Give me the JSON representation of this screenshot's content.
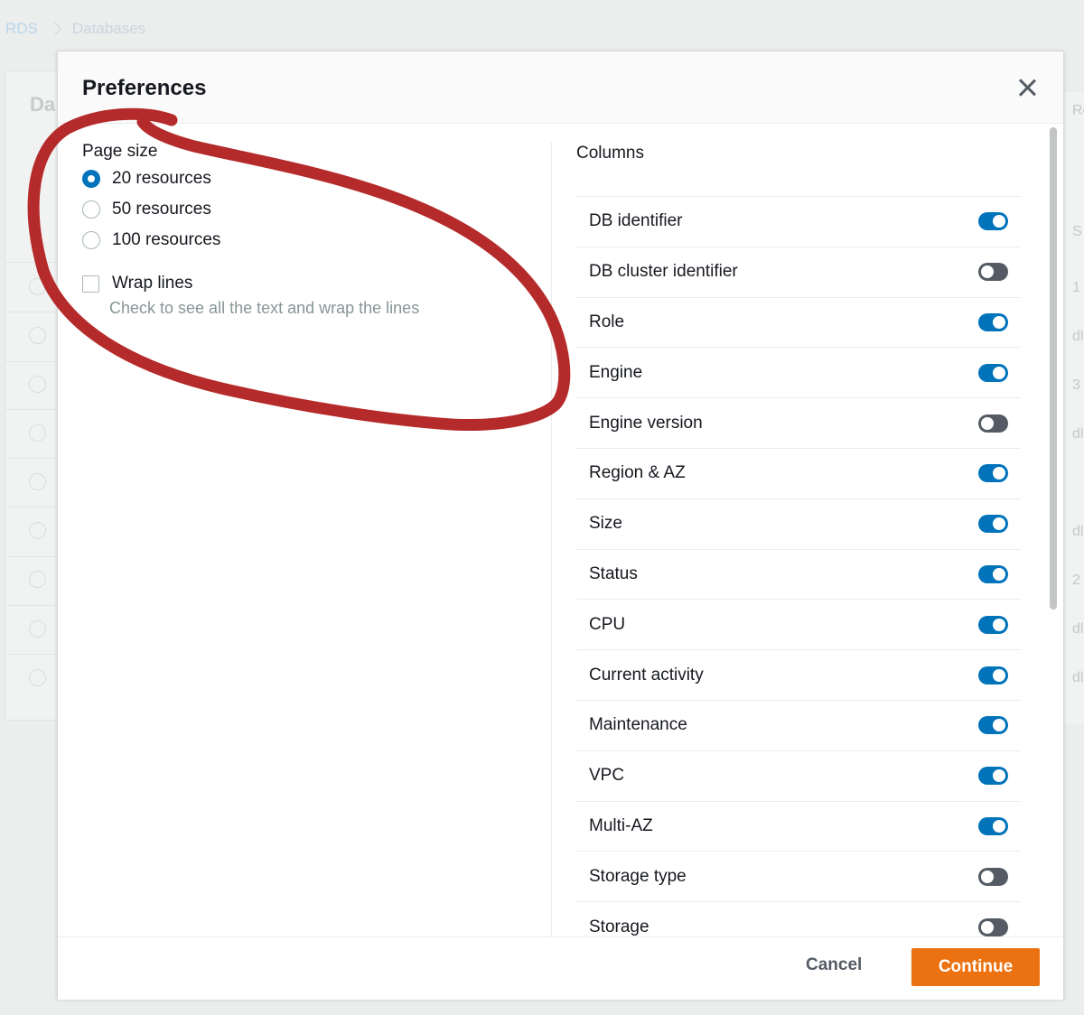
{
  "background": {
    "breadcrumb": [
      "RDS",
      "Databases"
    ],
    "title_fragment": "Da",
    "right_header_fragment": "Re",
    "right_values": [
      "S",
      "1",
      "dl",
      "3",
      "dl",
      "dl",
      "2",
      "dl",
      "dl"
    ]
  },
  "modal": {
    "title": "Preferences",
    "page_size": {
      "label": "Page size",
      "options": [
        {
          "label": "20 resources",
          "checked": true
        },
        {
          "label": "50 resources",
          "checked": false
        },
        {
          "label": "100 resources",
          "checked": false
        }
      ]
    },
    "wrap_lines": {
      "label": "Wrap lines",
      "description": "Check to see all the text and wrap the lines",
      "checked": false
    },
    "columns": {
      "title": "Columns",
      "items": [
        {
          "label": "DB identifier",
          "on": true
        },
        {
          "label": "DB cluster identifier",
          "on": false
        },
        {
          "label": "Role",
          "on": true
        },
        {
          "label": "Engine",
          "on": true
        },
        {
          "label": "Engine version",
          "on": false
        },
        {
          "label": "Region & AZ",
          "on": true
        },
        {
          "label": "Size",
          "on": true
        },
        {
          "label": "Status",
          "on": true
        },
        {
          "label": "CPU",
          "on": true
        },
        {
          "label": "Current activity",
          "on": true
        },
        {
          "label": "Maintenance",
          "on": true
        },
        {
          "label": "VPC",
          "on": true
        },
        {
          "label": "Multi-AZ",
          "on": true
        },
        {
          "label": "Storage type",
          "on": false
        },
        {
          "label": "Storage",
          "on": false
        }
      ]
    },
    "footer": {
      "cancel_label": "Cancel",
      "continue_label": "Continue"
    }
  },
  "colors": {
    "accent_blue": "#0073bb",
    "toggle_off": "#545b64",
    "primary_orange": "#ec7211",
    "annotation_red": "#b52a2a"
  }
}
